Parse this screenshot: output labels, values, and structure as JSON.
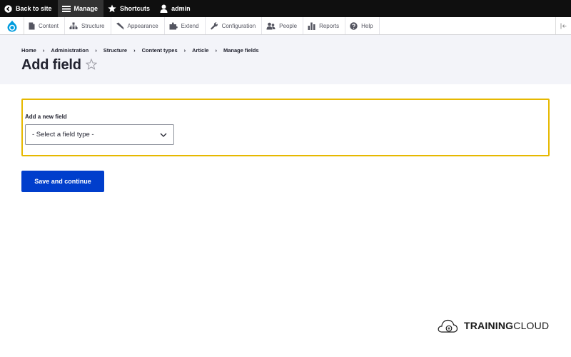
{
  "toolbar": {
    "back_label": "Back to site",
    "manage_label": "Manage",
    "shortcuts_label": "Shortcuts",
    "user_label": "admin"
  },
  "tray": {
    "items": [
      {
        "label": "Content",
        "icon": "file-icon"
      },
      {
        "label": "Structure",
        "icon": "hierarchy-icon"
      },
      {
        "label": "Appearance",
        "icon": "paintbrush-icon"
      },
      {
        "label": "Extend",
        "icon": "puzzle-icon"
      },
      {
        "label": "Configuration",
        "icon": "wrench-icon"
      },
      {
        "label": "People",
        "icon": "people-icon"
      },
      {
        "label": "Reports",
        "icon": "bar-chart-icon"
      },
      {
        "label": "Help",
        "icon": "help-icon"
      }
    ]
  },
  "breadcrumb": [
    "Home",
    "Administration",
    "Structure",
    "Content types",
    "Article",
    "Manage fields"
  ],
  "page": {
    "title": "Add field"
  },
  "form": {
    "field_label": "Add a new field",
    "select_value": "- Select a field type -",
    "submit_label": "Save and continue"
  },
  "watermark": {
    "brand_bold": "TRAINING",
    "brand_rest": "CLOUD"
  },
  "colors": {
    "primary": "#003ecc",
    "focus_border": "#e6b800",
    "toolbar_bg": "#0f0f0f"
  }
}
